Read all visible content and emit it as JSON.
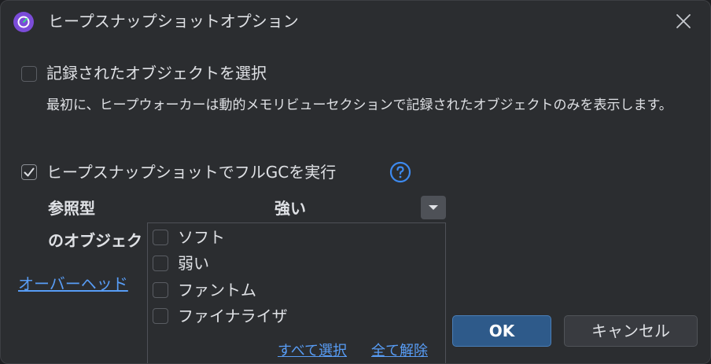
{
  "window": {
    "title": "ヒープスナップショットオプション",
    "icon": "app-profiler-icon",
    "close_icon": "close-icon"
  },
  "select_recorded": {
    "label": "記録されたオブジェクトを選択",
    "checked": false,
    "description": "最初に、ヒープウォーカーは動的メモリビューセクションで記録されたオブジェクトのみを表示します。"
  },
  "full_gc": {
    "label": "ヒープスナップショットでフルGCを実行",
    "checked": true,
    "help_icon": "help-icon"
  },
  "reference_type": {
    "label": "参照型",
    "value": "強い"
  },
  "objects_label": "のオブジェク",
  "overhead_link": "オーバーヘッド",
  "dropdown": {
    "options": [
      {
        "label": "ソフト",
        "checked": false
      },
      {
        "label": "弱い",
        "checked": false
      },
      {
        "label": "ファントム",
        "checked": false
      },
      {
        "label": "ファイナライザ",
        "checked": false
      }
    ],
    "select_all": "すべて選択",
    "deselect_all": "全て解除"
  },
  "buttons": {
    "ok": "OK",
    "cancel": "キャンセル"
  },
  "colors": {
    "background": "#2b2d30",
    "accent_link": "#589df6",
    "ok_button": "#2e5a8a",
    "app_icon": "#7b4cd8"
  }
}
